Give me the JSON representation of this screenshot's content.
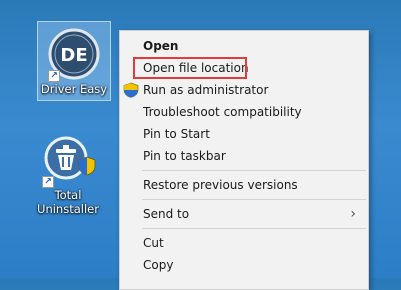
{
  "desktop": {
    "icons": [
      {
        "label": "Driver Easy",
        "logo_text": "DE"
      },
      {
        "label_line1": "Total",
        "label_line2": "Uninstaller"
      }
    ]
  },
  "context_menu": {
    "items": [
      {
        "label": "Open"
      },
      {
        "label": "Open file location"
      },
      {
        "label": "Run as administrator"
      },
      {
        "label": "Troubleshoot compatibility"
      },
      {
        "label": "Pin to Start"
      },
      {
        "label": "Pin to taskbar"
      },
      {
        "label": "Restore previous versions"
      },
      {
        "label": "Send to",
        "submenu_glyph": "›"
      },
      {
        "label": "Cut"
      },
      {
        "label": "Copy"
      }
    ]
  },
  "colors": {
    "desktop_bg": "#2c7ec6",
    "menu_bg": "#f2f2f2",
    "highlight_border": "#e03c3c"
  }
}
